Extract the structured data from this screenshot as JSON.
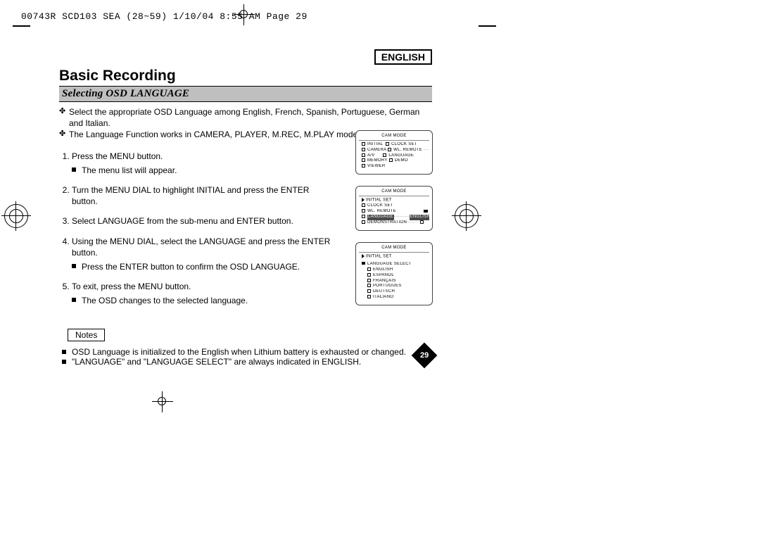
{
  "print_header": "00743R SCD103 SEA (28~59)  1/10/04 8:55 AM  Page 29",
  "language_box": "ENGLISH",
  "title": "Basic Recording",
  "subhead": "Selecting OSD LANGUAGE",
  "intro": [
    "Select the appropriate OSD Language among English, French, Spanish, Portuguese, German and Italian.",
    "The Language Function works in CAMERA, PLAYER, M.REC, M.PLAY modes."
  ],
  "steps": [
    {
      "text": "Press the MENU button.",
      "sub": [
        "The menu list will appear."
      ]
    },
    {
      "text": "Turn the MENU DIAL to highlight INITIAL and press the ENTER button."
    },
    {
      "text": "Select LANGUAGE from the sub-menu and ENTER button."
    },
    {
      "text": "Using the MENU DIAL, select the LANGUAGE and press the ENTER button.",
      "sub": [
        "Press the ENTER button to confirm the OSD LANGUAGE."
      ]
    },
    {
      "text": "To exit, press the MENU button.",
      "sub": [
        "The OSD changes to the selected language."
      ]
    }
  ],
  "notes_label": "Notes",
  "notes": [
    "OSD Language is initialized to the English when Lithium battery is exhausted or changed.",
    "\"LANGUAGE\" and \"LANGUAGE SELECT\" are always indicated in ENGLISH."
  ],
  "osd1": {
    "header": "CAM  MODE",
    "left": [
      "INITIAL",
      "CAMERA",
      "A/V",
      "MEMORY",
      "VIEWER"
    ],
    "right": [
      "CLOCK SET",
      "WL. REMOTE",
      "LANGUAGE",
      "DEMO"
    ]
  },
  "osd2": {
    "header": "CAM  MODE",
    "section": "INITIAL SET",
    "items": [
      "CLOCK SET",
      "WL. REMOTE",
      "LANGUAGE",
      "DEMONSTRATION"
    ],
    "hl_index": 2,
    "hl_value": "ENGLISH"
  },
  "osd3": {
    "header": "CAM  MODE",
    "section": "INITIAL SET",
    "subsection": "LANGUAGE SELECT",
    "langs": [
      "ENGLISH",
      "ESPAÑOL",
      "FRANÇAIS",
      "PORTUGUÊS",
      "DEUTSCH",
      "ITALIANO"
    ]
  },
  "page_number": "29"
}
